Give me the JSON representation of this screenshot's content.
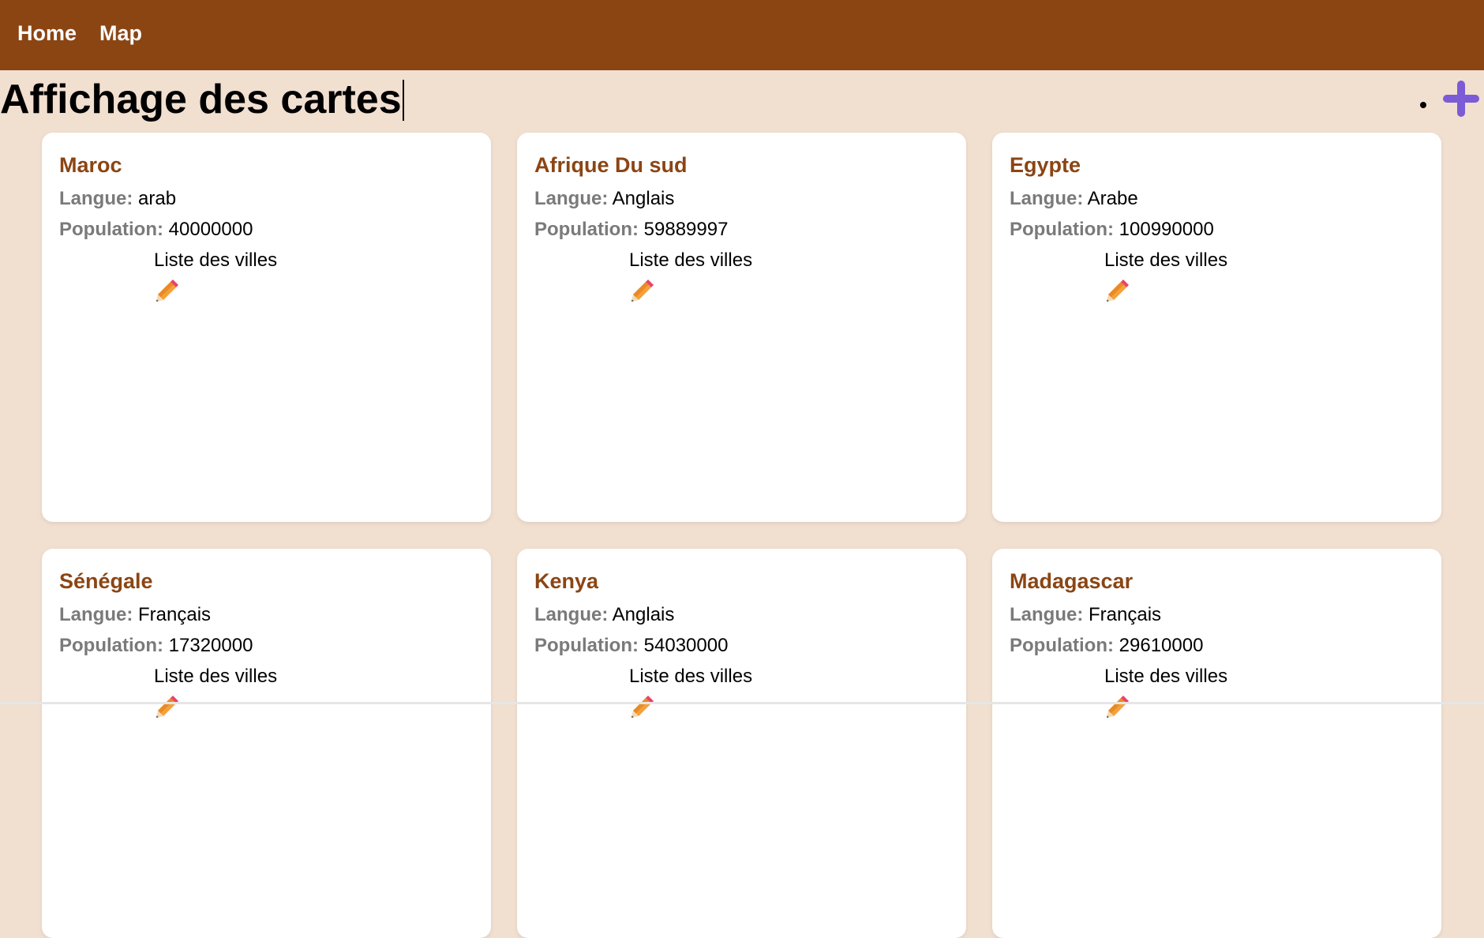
{
  "nav": {
    "home_label": "Home",
    "map_label": "Map"
  },
  "page": {
    "title": "Affichage des cartes"
  },
  "card_labels": {
    "langue_label": "Langue:",
    "population_label": "Population:",
    "cities_link": "Liste des villes"
  },
  "countries": [
    {
      "name": "Maroc",
      "langue": "arab",
      "population": "40000000"
    },
    {
      "name": "Afrique Du sud",
      "langue": "Anglais",
      "population": "59889997"
    },
    {
      "name": "Egypte",
      "langue": "Arabe",
      "population": "100990000"
    },
    {
      "name": "Sénégale",
      "langue": "Français",
      "population": "17320000"
    },
    {
      "name": "Kenya",
      "langue": "Anglais",
      "population": "54030000"
    },
    {
      "name": "Madagascar",
      "langue": "Français",
      "population": "29610000"
    }
  ],
  "icons": {
    "add": "plus-icon",
    "edit": "pencil-icon"
  },
  "colors": {
    "navbar": "#8B4513",
    "background": "#F1DFD0",
    "country_name": "#8B4513",
    "label": "#7a7a7a",
    "add_button": "#7B5CD6"
  }
}
